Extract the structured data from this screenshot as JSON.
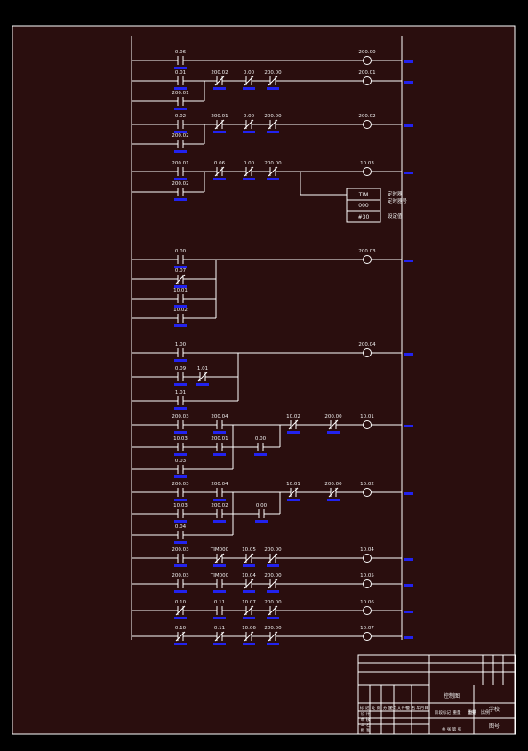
{
  "colors": {
    "background": "#000000",
    "paper": "#2a0e0e",
    "wire": "#ffffff",
    "label": "#f0f0f0",
    "comment": "#2222ee"
  },
  "rungs": [
    {
      "elements": [
        {
          "type": "NO",
          "label": "0.06"
        },
        {
          "type": "coil",
          "label": "200.00"
        }
      ],
      "branches": [],
      "output_comment": "▬▬"
    },
    {
      "elements": [
        {
          "type": "NO",
          "label": "0.01"
        },
        {
          "type": "NC",
          "label": "200.02"
        },
        {
          "type": "NC",
          "label": "0.00"
        },
        {
          "type": "NC",
          "label": "200.00"
        },
        {
          "type": "coil",
          "label": "200.01"
        }
      ],
      "branches": [
        {
          "label": "200.01",
          "type": "NO"
        }
      ],
      "output_comment": "▬▬"
    },
    {
      "elements": [
        {
          "type": "NO",
          "label": "0.02"
        },
        {
          "type": "NC",
          "label": "200.01"
        },
        {
          "type": "NC",
          "label": "0.00"
        },
        {
          "type": "NC",
          "label": "200.00"
        },
        {
          "type": "coil",
          "label": "200.02"
        }
      ],
      "branches": [
        {
          "label": "200.02",
          "type": "NO"
        }
      ],
      "output_comment": "▬▬"
    },
    {
      "elements": [
        {
          "type": "NO",
          "label": "200.01"
        },
        {
          "type": "NC",
          "label": "0.06"
        },
        {
          "type": "NC",
          "label": "0.00"
        },
        {
          "type": "NC",
          "label": "200.00"
        },
        {
          "type": "coil",
          "label": "10.03"
        }
      ],
      "branches": [
        {
          "label": "200.02",
          "type": "NO"
        }
      ],
      "output_comment": "▬▬",
      "timer": {
        "title": "TIM",
        "number": "000",
        "preset": "#30",
        "notes": [
          "定时器",
          "定时器号",
          "设定值"
        ]
      }
    },
    {
      "elements": [
        {
          "type": "NO",
          "label": "0.00"
        },
        {
          "type": "coil",
          "label": "200.03"
        }
      ],
      "branches": [
        {
          "label": "0.07",
          "type": "NC"
        },
        {
          "label": "10.01",
          "type": "NO"
        },
        {
          "label": "10.02",
          "type": "NO"
        }
      ],
      "output_comment": "▬▬"
    },
    {
      "elements": [
        {
          "type": "NO",
          "label": "1.00"
        },
        {
          "type": "coil",
          "label": "200.04"
        }
      ],
      "branches": [
        {
          "label": "0.09",
          "type": "NO",
          "second": "1.01"
        },
        {
          "label": "1.01",
          "type": "NO"
        }
      ],
      "output_comment": "▬▬"
    },
    {
      "elements": [
        {
          "type": "NO",
          "label": "200.03"
        },
        {
          "type": "NO",
          "label": "200.04"
        },
        {
          "type": "NC",
          "label": "10.02"
        },
        {
          "type": "NC",
          "label": "200.00"
        },
        {
          "type": "coil",
          "label": "10.01"
        }
      ],
      "branches": [
        {
          "label": "10.03",
          "type": "NO",
          "second": "200.01",
          "third": "0.00"
        },
        {
          "label": "0.03",
          "type": "NO"
        }
      ],
      "output_comment": "▬▬"
    },
    {
      "elements": [
        {
          "type": "NO",
          "label": "200.03"
        },
        {
          "type": "NO",
          "label": "200.04"
        },
        {
          "type": "NC",
          "label": "10.01"
        },
        {
          "type": "NC",
          "label": "200.00"
        },
        {
          "type": "coil",
          "label": "10.02"
        }
      ],
      "branches": [
        {
          "label": "10.03",
          "type": "NO",
          "second": "200.02",
          "third": "0.00"
        },
        {
          "label": "0.04",
          "type": "NO"
        }
      ],
      "output_comment": "▬▬"
    },
    {
      "elements": [
        {
          "type": "NO",
          "label": "200.03"
        },
        {
          "type": "NC",
          "label": "TIM000"
        },
        {
          "type": "NC",
          "label": "10.05"
        },
        {
          "type": "NC",
          "label": "200.00"
        },
        {
          "type": "coil",
          "label": "10.04"
        }
      ],
      "branches": [],
      "output_comment": "▬▬"
    },
    {
      "elements": [
        {
          "type": "NO",
          "label": "200.03"
        },
        {
          "type": "NO",
          "label": "TIM000"
        },
        {
          "type": "NC",
          "label": "10.04"
        },
        {
          "type": "NC",
          "label": "200.00"
        },
        {
          "type": "coil",
          "label": "10.05"
        }
      ],
      "branches": [],
      "output_comment": "▬▬"
    },
    {
      "elements": [
        {
          "type": "NC",
          "label": "0.10"
        },
        {
          "type": "NO",
          "label": "0.11"
        },
        {
          "type": "NC",
          "label": "10.07"
        },
        {
          "type": "NC",
          "label": "200.00"
        },
        {
          "type": "coil",
          "label": "10.06"
        }
      ],
      "branches": [],
      "output_comment": "▬▬"
    },
    {
      "elements": [
        {
          "type": "NC",
          "label": "0.10"
        },
        {
          "type": "NC",
          "label": "0.11"
        },
        {
          "type": "NC",
          "label": "10.06"
        },
        {
          "type": "NC",
          "label": "200.00"
        },
        {
          "type": "coil",
          "label": "10.07"
        }
      ],
      "branches": [],
      "output_comment": "▬▬"
    }
  ],
  "title_block": {
    "drawing_name": "控制图",
    "company": "学校",
    "sheet": "图号",
    "scale_label": "比例",
    "weight_label": "重量",
    "header_cells": [
      "标 记",
      "处 数",
      "分 区",
      "更改文件号",
      "签 名",
      "年月日"
    ],
    "role_cells": [
      "设 计",
      "审 核",
      "工 艺",
      "批 准"
    ],
    "stage_cells": [
      "阶段标记",
      "重量",
      "比例"
    ],
    "sheet_count": "共 张 第 张"
  }
}
